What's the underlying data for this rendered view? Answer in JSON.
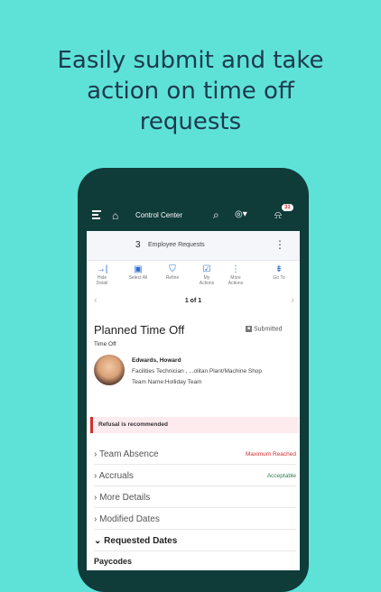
{
  "headline": [
    "Easily submit and take",
    "action on time off",
    "requests"
  ],
  "app": {
    "topbar": {
      "title": "Control Center",
      "notification_count": "31",
      "icons": [
        "menu-icon",
        "home-icon",
        "search-icon",
        "help-icon",
        "bell-icon"
      ]
    },
    "requests": {
      "count": "3",
      "label": "Employee Requests"
    },
    "toolbar": [
      {
        "icon": "→|",
        "label1": "Hide",
        "label2": "Detail"
      },
      {
        "icon": "▣",
        "label1": "Select All",
        "label2": ""
      },
      {
        "icon": "⛉",
        "label1": "Refine",
        "label2": ""
      },
      {
        "icon": "☑",
        "label1": "My",
        "label2": "Actions"
      },
      {
        "icon": "⋮",
        "label1": "More",
        "label2": "Actions"
      },
      {
        "icon": "⇟",
        "label1": "Go To",
        "label2": ""
      }
    ],
    "pager": "1 of 1",
    "detail": {
      "title": "Planned Time Off",
      "status": "Submitted",
      "subtitle": "Time Off",
      "employee_name": "Edwards, Howard",
      "employee_dept": "Facilities Technician , ...olitan Plant/Machine Shop",
      "employee_team": "Team Name:Holliday Team",
      "alert": "Refusal is recommended"
    },
    "sections": [
      {
        "label": "Team Absence",
        "value": "Maximum Reached",
        "value_color": "#d22f2f",
        "chevron": "›"
      },
      {
        "label": "Accruals",
        "value": "Acceptable",
        "value_color": "#2e7d4b",
        "chevron": "›"
      },
      {
        "label": "More Details",
        "value": "",
        "chevron": "›"
      },
      {
        "label": "Modified Dates",
        "value": "",
        "chevron": "›"
      },
      {
        "label": "Requested Dates",
        "value": "",
        "chevron": "⌄",
        "expanded": true
      }
    ],
    "paycodes_label": "Paycodes"
  },
  "colors": {
    "background": "#5ee2d8",
    "phone": "#0f3b39",
    "accent": "#2b6fd3",
    "alert": "#d22f2f"
  }
}
